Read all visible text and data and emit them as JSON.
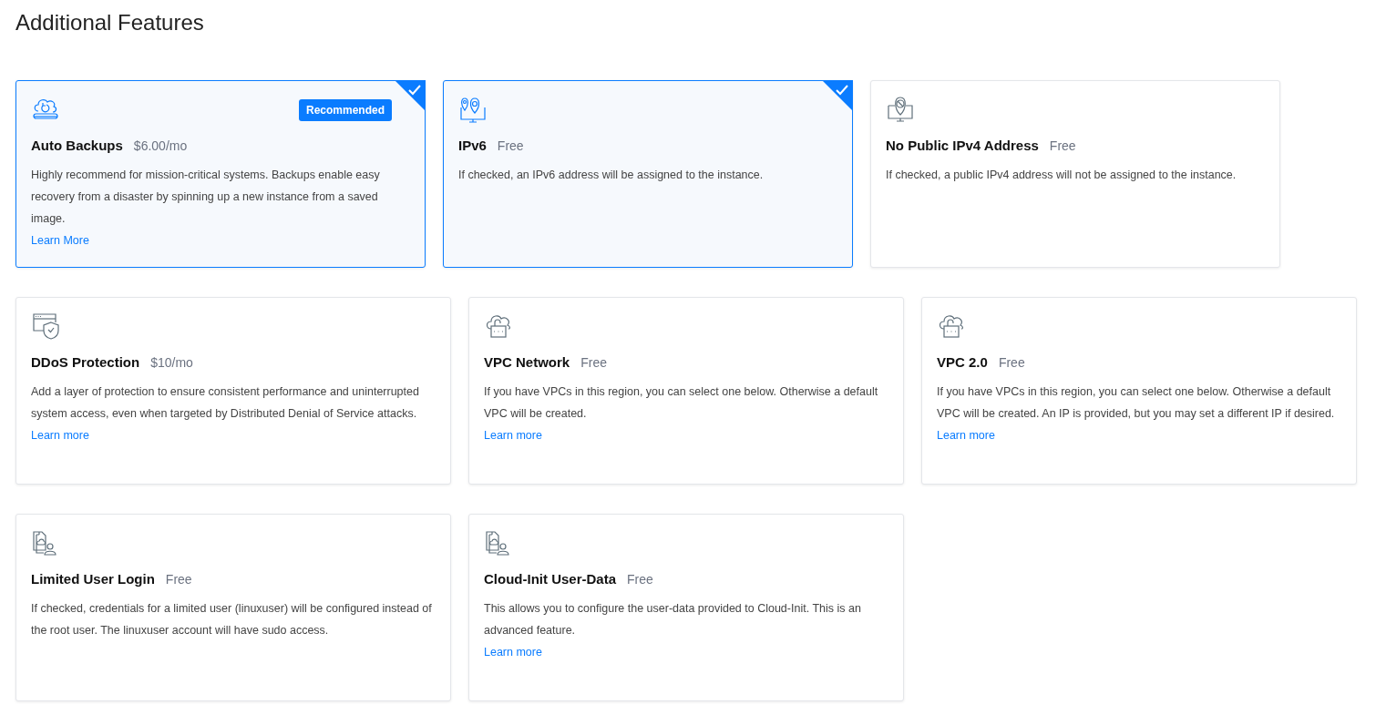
{
  "heading": "Additional Features",
  "rows": [
    [
      {
        "kind": "backup",
        "title": "Auto Backups",
        "price": "$6.00/mo",
        "badge": "Recommended",
        "selected": true,
        "description": "Highly recommend for mission-critical systems. Backups enable easy recovery from a disaster by spinning up a new instance from a saved image.",
        "link": "Learn More"
      },
      {
        "kind": "ipv6",
        "title": "IPv6",
        "price": "Free",
        "selected": true,
        "description": "If checked, an IPv6 address will be assigned to the instance."
      },
      {
        "kind": "noipv4",
        "title": "No Public IPv4 Address",
        "price": "Free",
        "selected": false,
        "description": "If checked, a public IPv4 address will not be assigned to the instance."
      }
    ],
    [
      {
        "kind": "ddos",
        "title": "DDoS Protection",
        "price": "$10/mo",
        "selected": false,
        "description": "Add a layer of protection to ensure consistent performance and uninterrupted system access, even when targeted by Distributed Denial of Service attacks.",
        "link": "Learn more"
      },
      {
        "kind": "vpc",
        "title": "VPC Network",
        "price": "Free",
        "selected": false,
        "description": "If you have VPCs in this region, you can select one below. Otherwise a default VPC will be created.",
        "link": "Learn more"
      },
      {
        "kind": "vpc",
        "title": "VPC 2.0",
        "price": "Free",
        "selected": false,
        "description": "If you have VPCs in this region, you can select one below. Otherwise a default VPC will be created. An IP is provided, but you may set a different IP if desired.",
        "link": "Learn more"
      }
    ],
    [
      {
        "kind": "user",
        "title": "Limited User Login",
        "price": "Free",
        "selected": false,
        "description": "If checked, credentials for a limited user (linuxuser) will be configured instead of the root user. The linuxuser account will have sudo access."
      },
      {
        "kind": "user",
        "title": "Cloud-Init User-Data",
        "price": "Free",
        "selected": false,
        "description": "This allows you to configure the user-data provided to Cloud-Init. This is an advanced feature.",
        "link": "Learn more"
      }
    ]
  ]
}
